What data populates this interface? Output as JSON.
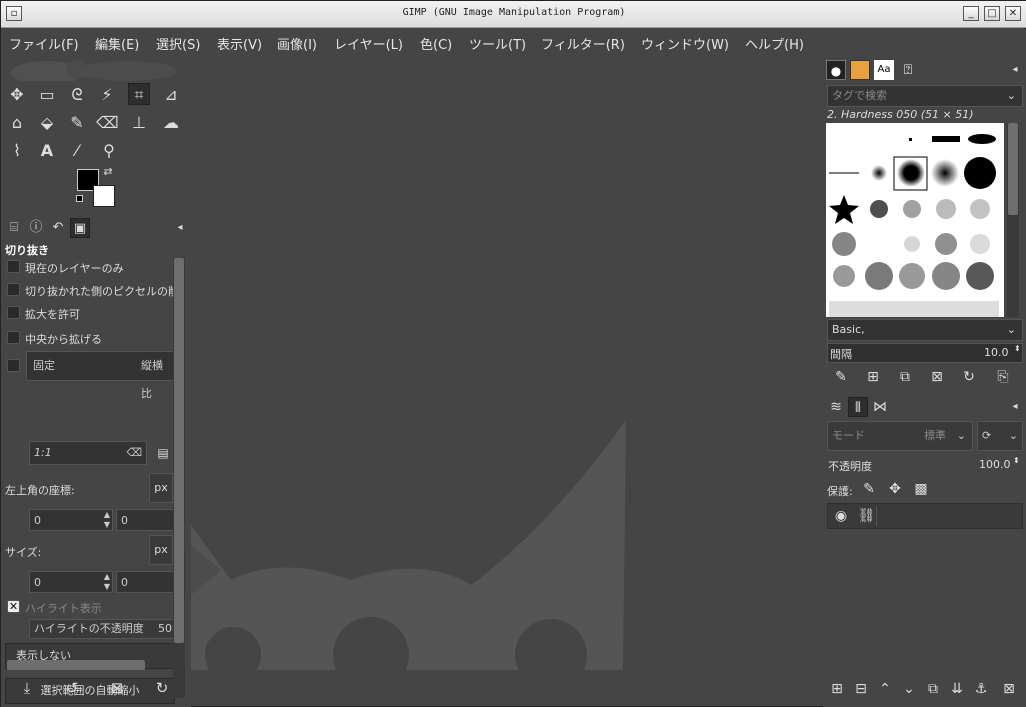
{
  "window": {
    "title": "GIMP (GNU Image Manipulation Program)"
  },
  "menu": [
    "ファイル(F)",
    "編集(E)",
    "選択(S)",
    "表示(V)",
    "画像(I)",
    "レイヤー(L)",
    "色(C)",
    "ツール(T)",
    "フィルター(R)",
    "ウィンドウ(W)",
    "ヘルプ(H)"
  ],
  "tool_options": {
    "title": "切り抜き",
    "current_layer_only": "現在のレイヤーのみ",
    "delete_cropped": "切り抜かれた側のピクセルの削",
    "allow_growing": "拡大を許可",
    "expand_from_center": "中央から拡げる",
    "fixed_label": "固定",
    "fixed_mode": "縦横比",
    "ratio_value": "1:1",
    "position_label": "左上角の座標:",
    "unit": "px",
    "pos_x": "0",
    "pos_y": "0",
    "size_label": "サイズ:",
    "size_w": "0",
    "size_h": "0",
    "highlight": "ハイライト表示",
    "highlight_opacity_label": "ハイライトの不透明度",
    "highlight_opacity_value": "50",
    "guides": "表示しない",
    "auto_shrink": "選択範囲の自動縮小"
  },
  "brushes": {
    "tag_placeholder": "タグで検索",
    "selected_brush": "2. Hardness 050 (51 × 51)",
    "preset": "Basic,",
    "spacing_label": "間隔",
    "spacing_value": "10.0"
  },
  "layers": {
    "mode_label": "モード",
    "mode_value": "標準",
    "opacity_label": "不透明度",
    "opacity_value": "100.0",
    "lock_label": "保護:"
  },
  "colors": {
    "accent": "#e8a040",
    "foreground": "#000000",
    "background": "#ffffff"
  }
}
